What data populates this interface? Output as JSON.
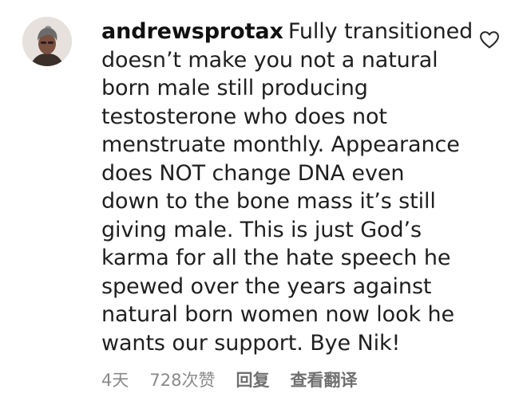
{
  "comment": {
    "username": "andrewsprotax",
    "text_lines": [
      "Fully transitioned",
      "doesn’t make you not a natural",
      "born male still producing",
      "testosterone who does not",
      "menstruate monthly. Appearance",
      "does NOT change DNA even",
      "down to the bone mass it’s still",
      "giving male. This is just God’s",
      "karma for all the hate speech he",
      "spewed over the years against",
      "natural born women now look he",
      "wants our support. Bye Nik!"
    ],
    "icons": {
      "avatar": "avatar-image",
      "like": "heart-outline-icon"
    }
  },
  "meta": {
    "age": "4天",
    "likes": "728次赞",
    "reply_label": "回复",
    "translate_label": "查看翻译"
  },
  "colors": {
    "text": "#1f1f1f",
    "username": "#111111",
    "meta": "#8a8a8a",
    "meta_action": "#6f6f6f",
    "background": "#ffffff"
  }
}
